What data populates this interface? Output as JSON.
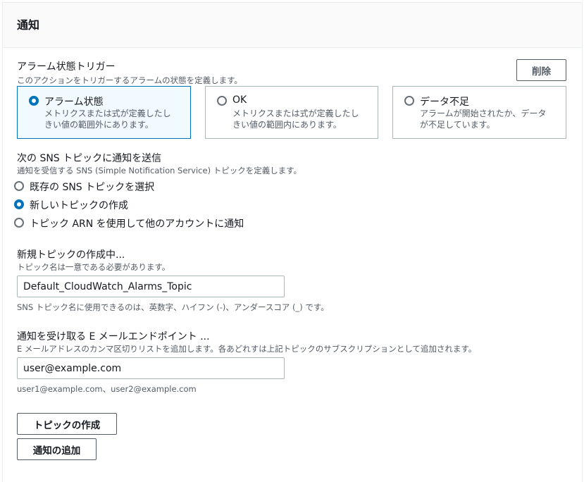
{
  "panel": {
    "title": "通知"
  },
  "trigger": {
    "label": "アラーム状態トリガー",
    "description": "このアクションをトリガーするアラームの状態を定義します。",
    "remove_label": "削除",
    "options": [
      {
        "title": "アラーム状態",
        "line1": "メトリクスまたは式が定義したし",
        "line2": "きい値の範囲外にあります。",
        "selected": true
      },
      {
        "title": "OK",
        "line1": "メトリクスまたは式が定義したし",
        "line2": "きい値の範囲内にあります。",
        "selected": false
      },
      {
        "title": "データ不足",
        "line1": "アラームが開始されたか、データ",
        "line2": "が不足しています。",
        "selected": false
      }
    ]
  },
  "sns": {
    "label": "次の SNS トピックに通知を送信",
    "description": "通知を受信する SNS (Simple Notification Service) トピックを定義します。",
    "options": [
      {
        "label": "既存の SNS トピックを選択",
        "selected": false
      },
      {
        "label": "新しいトピックの作成",
        "selected": true
      },
      {
        "label": "トピック ARN を使用して他のアカウントに通知",
        "selected": false
      }
    ]
  },
  "new_topic": {
    "label": "新規トピックの作成中...",
    "description": "トピック名は一意である必要があります。",
    "value": "Default_CloudWatch_Alarms_Topic",
    "hint": "SNS トピック名に使用できるのは、英数字、ハイフン (-)、アンダースコア (_) です。"
  },
  "email": {
    "label": "通知を受け取る E メールエンドポイント ...",
    "description": "E メールアドレスのカンマ区切りリストを追加します。各あどれすは上記トピックのサブスクリプションとして追加されます。",
    "value": "user@example.com",
    "hint": "user1@example.com、user2@example.com"
  },
  "actions": {
    "create_topic_label": "トピックの作成",
    "add_notification_label": "通知の追加"
  }
}
